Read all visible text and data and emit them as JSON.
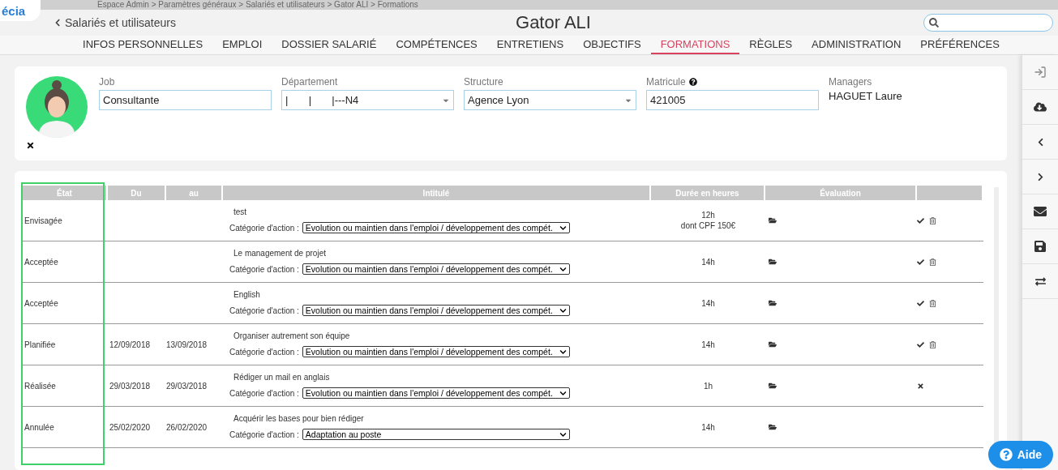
{
  "logo": "écia",
  "breadcrumb": "Espace Admin > Paramètres généraux > Salariés et utilisateurs > Gator ALI > Formations",
  "back_link": "Salariés et utilisateurs",
  "title": "Gator ALI",
  "tabs": [
    {
      "label": "INFOS PERSONNELLES",
      "selected": false
    },
    {
      "label": "EMPLOI",
      "selected": false
    },
    {
      "label": "DOSSIER SALARIÉ",
      "selected": false
    },
    {
      "label": "COMPÉTENCES",
      "selected": false
    },
    {
      "label": "ENTRETIENS",
      "selected": false
    },
    {
      "label": "OBJECTIFS",
      "selected": false
    },
    {
      "label": "FORMATIONS",
      "selected": true
    },
    {
      "label": "RÈGLES",
      "selected": false
    },
    {
      "label": "ADMINISTRATION",
      "selected": false
    },
    {
      "label": "PRÉFÉRENCES",
      "selected": false
    }
  ],
  "profile": {
    "fields": [
      {
        "label": "Job",
        "value": "Consultante",
        "kind": "text"
      },
      {
        "label": "Département",
        "value": "|       |       |---N4",
        "kind": "select"
      },
      {
        "label": "Structure",
        "value": "Agence Lyon",
        "kind": "select"
      },
      {
        "label": "Matricule",
        "value": "421005",
        "kind": "text",
        "help": true
      }
    ],
    "managers": {
      "label": "Managers",
      "value": "HAGUET Laure"
    }
  },
  "table": {
    "columns": [
      "État",
      "Du",
      "au",
      "Intitulé",
      "Durée en heures",
      "Évaluation",
      ""
    ],
    "rows": [
      {
        "state": "Envisagée",
        "from": "",
        "to": "",
        "title": "test",
        "category_label": "Catégorie d'action :",
        "category": "Evolution ou maintien dans l'emploi / développement des compét.",
        "duration": "12h",
        "duration_note": "dont CPF 150€",
        "validate": true,
        "delete": true,
        "cancel": false
      },
      {
        "state": "Acceptée",
        "from": "",
        "to": "",
        "title": "Le management de projet",
        "category_label": "Catégorie d'action :",
        "category": "Evolution ou maintien dans l'emploi / développement des compét.",
        "duration": "14h",
        "validate": true,
        "delete": true,
        "cancel": false
      },
      {
        "state": "Acceptée",
        "from": "",
        "to": "",
        "title": "English",
        "category_label": "Catégorie d'action :",
        "category": "Evolution ou maintien dans l'emploi / développement des compét.",
        "duration": "14h",
        "validate": true,
        "delete": true,
        "cancel": false
      },
      {
        "state": "Planifiée",
        "from": "12/09/2018",
        "to": "13/09/2018",
        "title": "Organiser autrement son équipe",
        "category_label": "Catégorie d'action :",
        "category": "Evolution ou maintien dans l'emploi / développement des compét.",
        "duration": "14h",
        "validate": true,
        "delete": true,
        "cancel": false
      },
      {
        "state": "Réalisée",
        "from": "29/03/2018",
        "to": "29/03/2018",
        "title": "Rédiger un mail en anglais",
        "category_label": "Catégorie d'action :",
        "category": "Evolution ou maintien dans l'emploi / développement des compét.",
        "duration": "1h",
        "validate": false,
        "delete": false,
        "cancel": true
      },
      {
        "state": "Annulée",
        "from": "25/02/2020",
        "to": "26/02/2020",
        "title": "Acquérir les bases pour bien rédiger",
        "category_label": "Catégorie d'action :",
        "category": "Adaptation au poste",
        "duration": "14h",
        "validate": false,
        "delete": false,
        "cancel": false
      }
    ]
  },
  "help_button": "Aide"
}
